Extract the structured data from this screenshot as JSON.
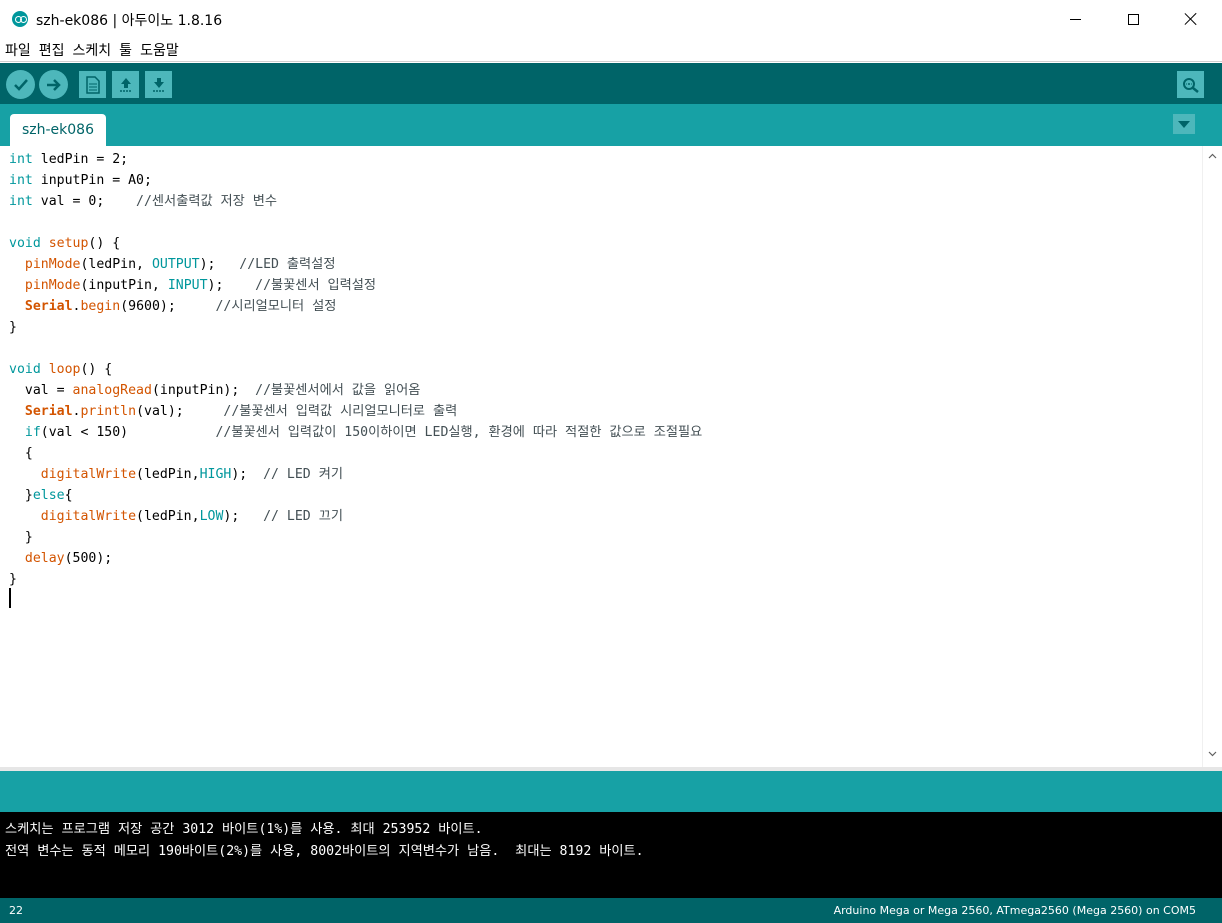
{
  "window": {
    "title": "szh-ek086 | 아두이노 1.8.16"
  },
  "menu": [
    "파일",
    "편집",
    "스케치",
    "툴",
    "도움말"
  ],
  "toolbar": {
    "buttons": [
      "verify-icon",
      "upload-icon",
      "new-icon",
      "open-icon",
      "save-icon"
    ],
    "serial_monitor": "serial-monitor-icon"
  },
  "tabs": [
    {
      "label": "szh-ek086"
    }
  ],
  "code_lines": [
    [
      [
        "kw",
        "int"
      ],
      [
        "",
        "ledPin = 2;"
      ]
    ],
    [
      [
        "kw",
        "int"
      ],
      [
        "",
        "inputPin = A0;"
      ]
    ],
    [
      [
        "kw",
        "int"
      ],
      [
        "",
        "val = 0;    "
      ],
      [
        "cm",
        "//센서출력값 저장 변수"
      ]
    ],
    [],
    [
      [
        "kw",
        "void"
      ],
      [
        "",
        " "
      ],
      [
        "fn",
        "setup"
      ],
      [
        "",
        "() {"
      ]
    ],
    [
      [
        "",
        "  "
      ],
      [
        "fn",
        "pinMode"
      ],
      [
        "",
        "(ledPin, "
      ],
      [
        "const",
        "OUTPUT"
      ],
      [
        "",
        "); "
      ],
      [
        "cm",
        "  //LED 출력설정"
      ]
    ],
    [
      [
        "",
        "  "
      ],
      [
        "fn",
        "pinMode"
      ],
      [
        "",
        "(inputPin, "
      ],
      [
        "const",
        "INPUT"
      ],
      [
        "",
        "); "
      ],
      [
        "cm",
        "   //불꽃센서 입력설정"
      ]
    ],
    [
      [
        "",
        "  "
      ],
      [
        "obj",
        "Serial"
      ],
      [
        "",
        "."
      ],
      [
        "fn",
        "begin"
      ],
      [
        "",
        "(9600); "
      ],
      [
        "cm",
        "    //시리얼모니터 설정"
      ]
    ],
    [
      [
        "",
        "}"
      ]
    ],
    [],
    [
      [
        "kw",
        "void"
      ],
      [
        "",
        " "
      ],
      [
        "fn",
        "loop"
      ],
      [
        "",
        "() {"
      ]
    ],
    [
      [
        "",
        "  val = "
      ],
      [
        "fn",
        "analogRead"
      ],
      [
        "",
        "(inputPin);  "
      ],
      [
        "cm",
        "//불꽃센서에서 값을 읽어옴"
      ]
    ],
    [
      [
        "",
        "  "
      ],
      [
        "obj",
        "Serial"
      ],
      [
        "",
        "."
      ],
      [
        "fn",
        "println"
      ],
      [
        "",
        "(val);     "
      ],
      [
        "cm",
        "//불꽃센서 입력값 시리얼모니터로 출력"
      ]
    ],
    [
      [
        "",
        "  "
      ],
      [
        "kw",
        "if"
      ],
      [
        "",
        "(val < 150)           "
      ],
      [
        "cm",
        "//불꽃센서 입력값이 150이하이면 LED실행, 환경에 따라 적절한 값으로 조절필요"
      ]
    ],
    [
      [
        "",
        "  {"
      ]
    ],
    [
      [
        "",
        "    "
      ],
      [
        "fn",
        "digitalWrite"
      ],
      [
        "",
        "(ledPin,"
      ],
      [
        "const",
        "HIGH"
      ],
      [
        "",
        "); "
      ],
      [
        "cm",
        " // LED 켜기"
      ]
    ],
    [
      [
        "",
        "  }"
      ],
      [
        "kw",
        "else"
      ],
      [
        "",
        "{"
      ]
    ],
    [
      [
        "",
        "    "
      ],
      [
        "fn",
        "digitalWrite"
      ],
      [
        "",
        "(ledPin,"
      ],
      [
        "const",
        "LOW"
      ],
      [
        "",
        "); "
      ],
      [
        "cm",
        "  // LED 끄기"
      ]
    ],
    [
      [
        "",
        "  }"
      ]
    ],
    [
      [
        "",
        "  "
      ],
      [
        "fn",
        "delay"
      ],
      [
        "",
        "(500);"
      ]
    ],
    [
      [
        "",
        "}"
      ]
    ]
  ],
  "console": {
    "line1": "스케치는 프로그램 저장 공간 3012 바이트(1%)를 사용. 최대 253952 바이트.",
    "line2": "전역 변수는 동적 메모리 190바이트(2%)를 사용, 8002바이트의 지역변수가 남음.  최대는 8192 바이트."
  },
  "status": {
    "line_number": "22",
    "board": "Arduino Mega or Mega 2560, ATmega2560 (Mega 2560) on COM5"
  },
  "colors": {
    "toolbar": "#006468",
    "tabbar": "#17a1a5",
    "button": "#4db7bb",
    "keyword": "#00979c",
    "function": "#d35400"
  }
}
